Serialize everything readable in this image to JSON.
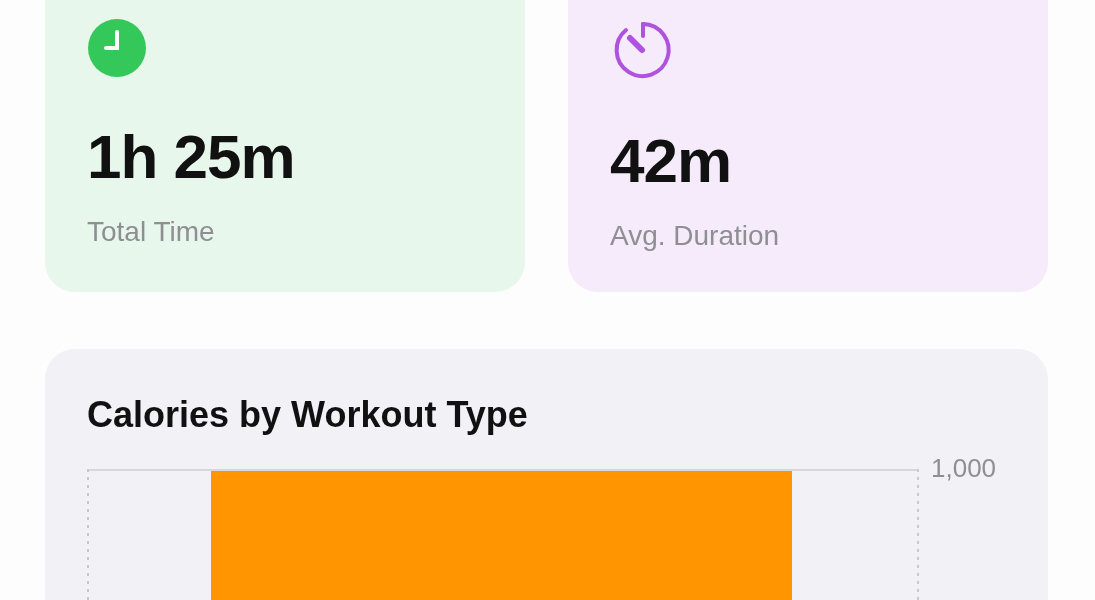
{
  "stats": [
    {
      "kind": "clock",
      "color": "#34c759",
      "value": "1h 25m",
      "label": "Total Time"
    },
    {
      "kind": "timer",
      "color": "#af52de",
      "value": "42m",
      "label": "Avg. Duration"
    }
  ],
  "chart_card": {
    "title": "Calories by Workout Type",
    "tick_label": "1,000"
  }
}
